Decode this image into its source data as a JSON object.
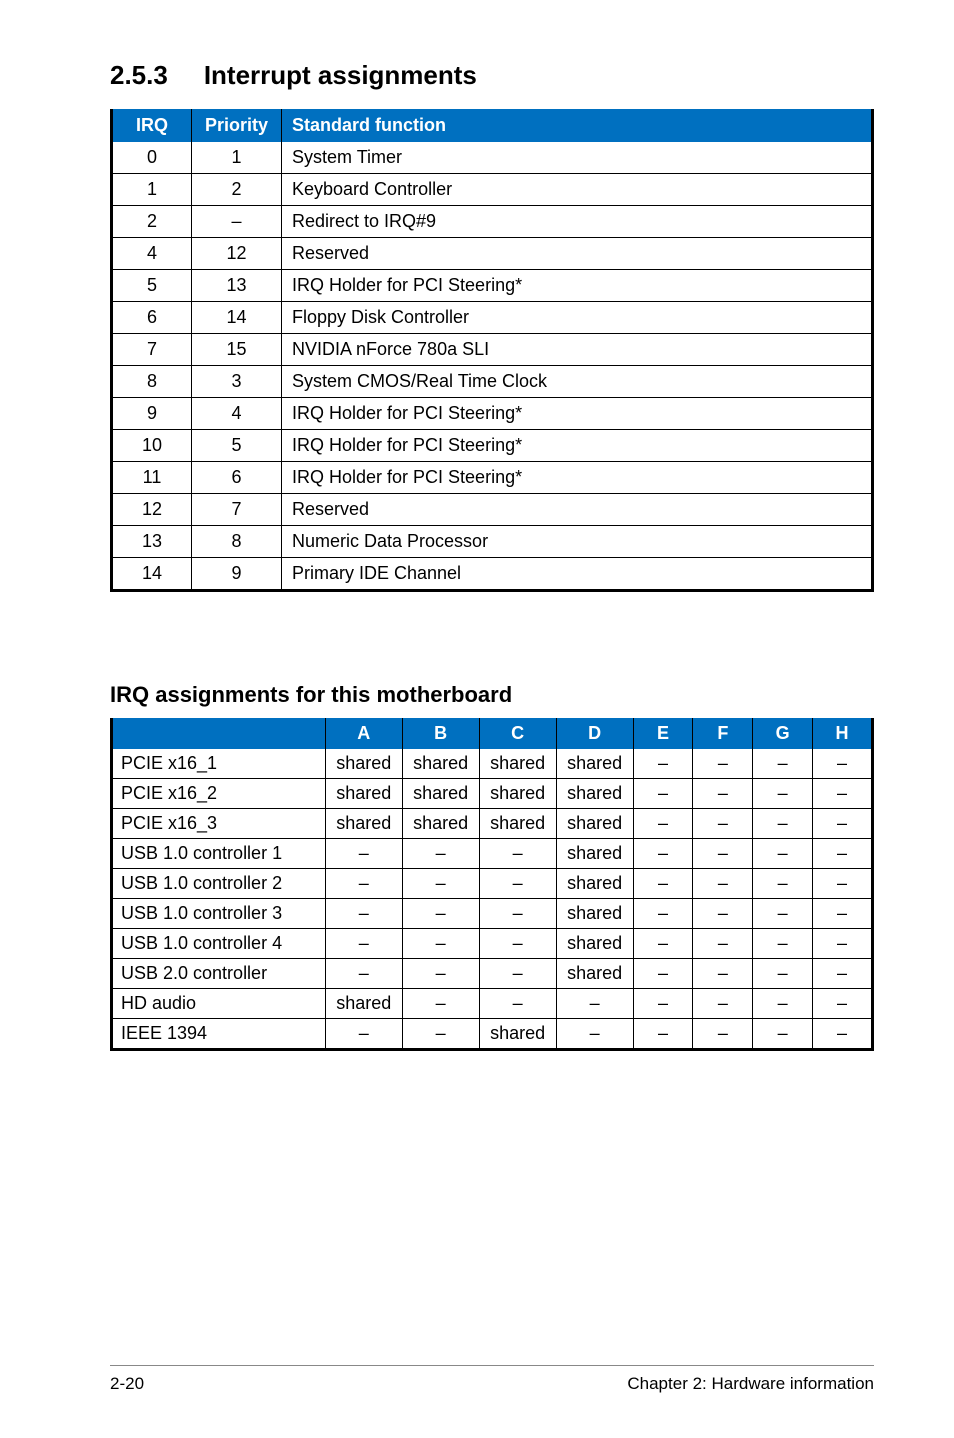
{
  "section": {
    "number": "2.5.3",
    "title": "Interrupt assignments"
  },
  "irq_table": {
    "headers": [
      "IRQ",
      "Priority",
      "Standard function"
    ],
    "rows": [
      {
        "irq": "0",
        "priority": "1",
        "func": "System Timer"
      },
      {
        "irq": "1",
        "priority": "2",
        "func": "Keyboard Controller"
      },
      {
        "irq": "2",
        "priority": "–",
        "func": "Redirect to IRQ#9"
      },
      {
        "irq": "4",
        "priority": "12",
        "func": "Reserved"
      },
      {
        "irq": "5",
        "priority": "13",
        "func": "IRQ Holder for PCI Steering*"
      },
      {
        "irq": "6",
        "priority": "14",
        "func": "Floppy Disk Controller"
      },
      {
        "irq": "7",
        "priority": "15",
        "func": "NVIDIA nForce 780a SLI"
      },
      {
        "irq": "8",
        "priority": "3",
        "func": "System CMOS/Real Time Clock"
      },
      {
        "irq": "9",
        "priority": "4",
        "func": "IRQ Holder for PCI Steering*"
      },
      {
        "irq": "10",
        "priority": "5",
        "func": "IRQ Holder for PCI Steering*"
      },
      {
        "irq": "11",
        "priority": "6",
        "func": "IRQ Holder for PCI Steering*"
      },
      {
        "irq": "12",
        "priority": "7",
        "func": "Reserved"
      },
      {
        "irq": "13",
        "priority": "8",
        "func": "Numeric Data Processor"
      },
      {
        "irq": "14",
        "priority": "9",
        "func": "Primary IDE Channel"
      }
    ]
  },
  "assign_title": "IRQ assignments for this motherboard",
  "assign_table": {
    "headers": [
      "",
      "A",
      "B",
      "C",
      "D",
      "E",
      "F",
      "G",
      "H"
    ],
    "rows": [
      {
        "name": "PCIE x16_1",
        "cells": [
          "shared",
          "shared",
          "shared",
          "shared",
          "–",
          "–",
          "–",
          "–"
        ]
      },
      {
        "name": "PCIE x16_2",
        "cells": [
          "shared",
          "shared",
          "shared",
          "shared",
          "–",
          "–",
          "–",
          "–"
        ]
      },
      {
        "name": "PCIE x16_3",
        "cells": [
          "shared",
          "shared",
          "shared",
          "shared",
          "–",
          "–",
          "–",
          "–"
        ]
      },
      {
        "name": "USB 1.0 controller 1",
        "cells": [
          "–",
          "–",
          "–",
          "shared",
          "–",
          "–",
          "–",
          "–"
        ]
      },
      {
        "name": "USB 1.0 controller 2",
        "cells": [
          "–",
          "–",
          "–",
          "shared",
          "–",
          "–",
          "–",
          "–"
        ]
      },
      {
        "name": "USB 1.0 controller 3",
        "cells": [
          "–",
          "–",
          "–",
          "shared",
          "–",
          "–",
          "–",
          "–"
        ]
      },
      {
        "name": "USB 1.0 controller 4",
        "cells": [
          "–",
          "–",
          "–",
          "shared",
          "–",
          "–",
          "–",
          "–"
        ]
      },
      {
        "name": "USB 2.0 controller",
        "cells": [
          "–",
          "–",
          "–",
          "shared",
          "–",
          "–",
          "–",
          "–"
        ]
      },
      {
        "name": "HD audio",
        "cells": [
          "shared",
          "–",
          "–",
          "–",
          "–",
          "–",
          "–",
          "–"
        ]
      },
      {
        "name": "IEEE 1394",
        "cells": [
          "–",
          "–",
          "shared",
          "–",
          "–",
          "–",
          "–",
          "–"
        ]
      }
    ]
  },
  "footer": {
    "left": "2-20",
    "right": "Chapter 2: Hardware information"
  }
}
